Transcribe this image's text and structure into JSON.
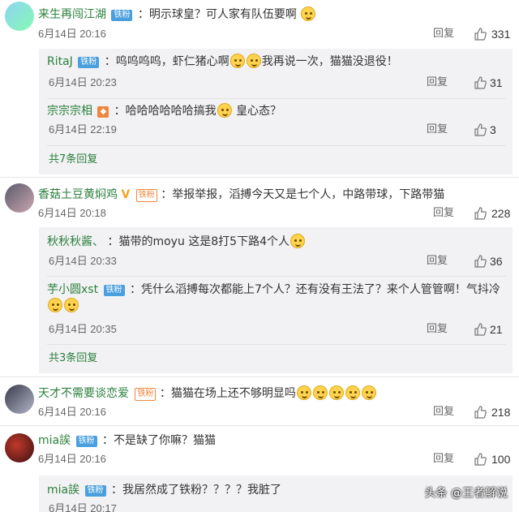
{
  "comments": [
    {
      "user": "来生再闯江湖",
      "badge": "铁粉",
      "text": "：明示球皇？可人家有队伍要啊",
      "time": "6月14日 20:16",
      "reply": "回复",
      "likes": "331",
      "replies": [
        {
          "user": "RitaJ",
          "badge": "铁粉",
          "text_a": "：呜呜呜呜，虾仁猪心啊",
          "text_b": "我再说一次，猫猫没退役！",
          "time": "6月14日 20:23",
          "reply": "回复",
          "likes": "31"
        },
        {
          "user": "宗宗宗相",
          "text_a": "：哈哈哈哈哈哈搞我",
          "text_b": "皇心态？",
          "time": "6月14日 22:19",
          "reply": "回复",
          "likes": "3"
        }
      ],
      "more": "共7条回复"
    },
    {
      "user": "香菇土豆黄焖鸡",
      "vtick": "V",
      "gold_badge": "铁粉",
      "text": "：举报举报，滔搏今天又是七个人，中路带球，下路带猫",
      "time": "6月14日 20:18",
      "reply": "回复",
      "likes": "228",
      "replies": [
        {
          "user": "秋秋秋酱、",
          "text_a": "：猫带的moyu 这是8打5下路4个人",
          "time": "6月14日 20:33",
          "reply": "回复",
          "likes": "36"
        },
        {
          "user": "芋小圆xst",
          "badge": "铁粉",
          "text_a": "：凭什么滔搏每次都能上7个人？还有没有王法了？来个人管管啊！气抖冷",
          "time": "6月14日 20:35",
          "reply": "回复",
          "likes": "21"
        }
      ],
      "more": "共3条回复"
    },
    {
      "user": "天才不需要谈恋爱",
      "gold_badge": "铁粉",
      "text": "：猫猫在场上还不够明显吗",
      "time": "6月14日 20:16",
      "reply": "回复",
      "likes": "218"
    },
    {
      "user": "mia誒",
      "badge": "铁粉",
      "text": "：不是缺了你嘛？猫猫",
      "time": "6月14日 20:16",
      "reply": "回复",
      "likes": "100",
      "replies": [
        {
          "user": "mia誒",
          "badge": "铁粉",
          "text_a": "：我居然成了铁粉？？？？我脏了",
          "time": "6月14日 20:17"
        }
      ]
    }
  ],
  "watermark": "头条 @王者解说",
  "colors": {
    "username": "#2a7f3b",
    "badge": "#4a9fde",
    "nested_bg": "#f2f2f5"
  }
}
